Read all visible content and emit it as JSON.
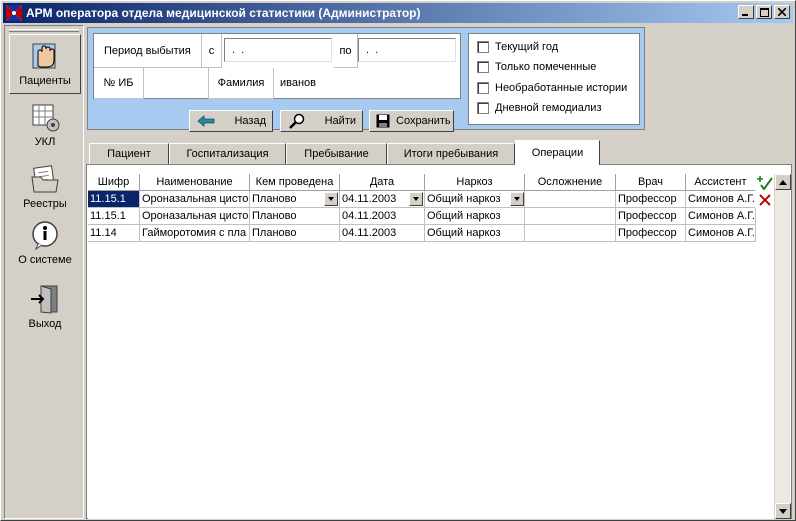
{
  "window": {
    "title": "АРМ оператора отдела медицинской статистики (Администратор)",
    "controls": {
      "minimize": "_",
      "maximize": "□",
      "close": "×"
    }
  },
  "sidebar": {
    "items": [
      {
        "label": "Пациенты",
        "icon": "patients-hand-icon",
        "active": true
      },
      {
        "label": "УКЛ",
        "icon": "ukl-grid-icon",
        "active": false
      },
      {
        "label": "Реестры",
        "icon": "registry-folder-icon",
        "active": false
      },
      {
        "label": "О системе",
        "icon": "info-icon",
        "active": false
      },
      {
        "label": "Выход",
        "icon": "exit-door-icon",
        "active": false
      }
    ]
  },
  "filter": {
    "period_label": "Период выбытия",
    "from_label": "с",
    "from_value": " .  .",
    "to_label": "по",
    "to_value": " .  .",
    "ib_label": "№ ИБ",
    "ib_value": "",
    "surname_label": "Фамилия",
    "surname_value": "иванов"
  },
  "checks": [
    {
      "label": "Текущий год",
      "checked": false
    },
    {
      "label": "Только помеченные",
      "checked": false
    },
    {
      "label": "Необработанные истории",
      "checked": false
    },
    {
      "label": "Дневной гемодиализ",
      "checked": false
    }
  ],
  "buttons": {
    "back": "Назад",
    "find": "Найти",
    "save": "Сохранить"
  },
  "tabs": [
    {
      "label": "Пациент",
      "active": false
    },
    {
      "label": "Госпитализация",
      "active": false
    },
    {
      "label": "Пребывание",
      "active": false
    },
    {
      "label": "Итоги пребывания",
      "active": false
    },
    {
      "label": "Операции",
      "active": true
    }
  ],
  "grid": {
    "columns": [
      "Шифр",
      "Наименование",
      "Кем проведена",
      "Дата",
      "Наркоз",
      "Осложнение",
      "Врач",
      "Ассистент"
    ],
    "rows": [
      [
        "11.15.1",
        "Ороназальная цисто",
        "Планово",
        "04.11.2003",
        "Общий наркоз",
        "",
        "Профессор",
        "Симонов А.Г."
      ],
      [
        "11.15.1",
        "Ороназальная цисто",
        "Планово",
        "04.11.2003",
        "Общий наркоз",
        "",
        "Профессор",
        "Симонов А.Г."
      ],
      [
        "11.14",
        "Гайморотомия с пла",
        "Планово",
        "04.11.2003",
        "Общий наркоз",
        "",
        "Профессор",
        "Симонов А.Г."
      ]
    ]
  },
  "colors": {
    "titlebar_start": "#0a246a",
    "titlebar_end": "#a6caf0",
    "filter_frame": "#a6caf0",
    "selection": "#0a246a"
  }
}
